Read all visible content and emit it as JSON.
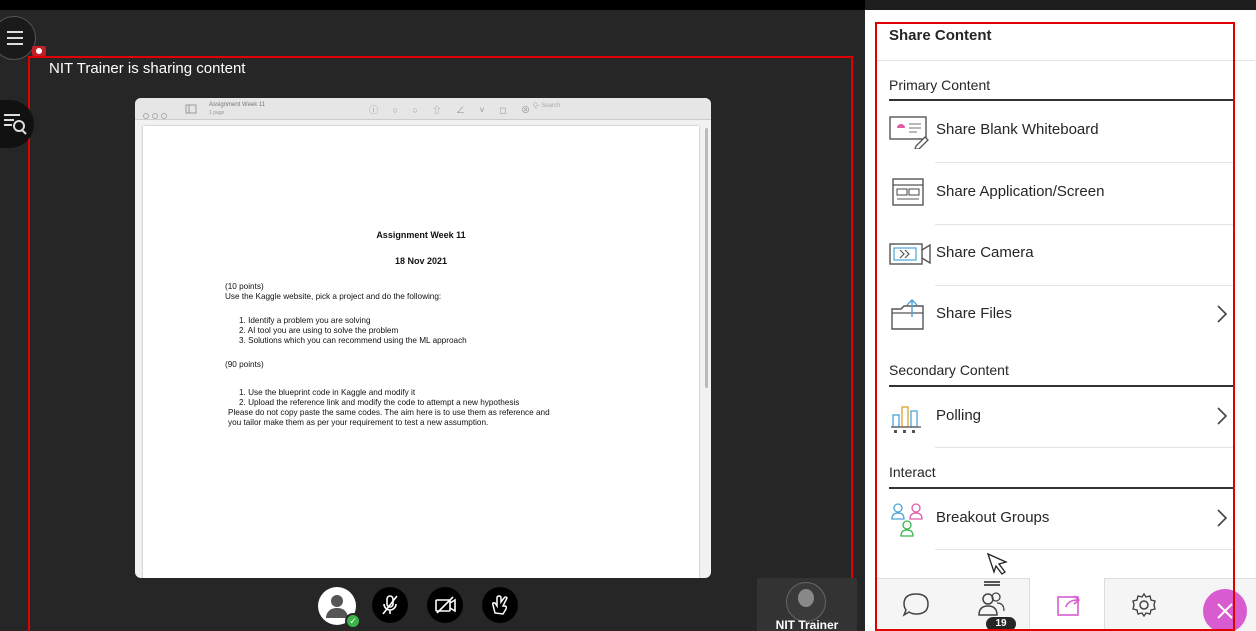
{
  "stage": {
    "sharing_label": "NIT Trainer is sharing content",
    "speaker_name": "NIT Trainer"
  },
  "document": {
    "toolbar_title": "Assignment Week 11",
    "toolbar_sub": "1 page",
    "toolbar_search": "Q- Search",
    "title": "Assignment Week 11",
    "date": "18 Nov 2021",
    "part1_points": "(10 points)",
    "part1_intro": "Use the Kaggle website, pick a project and do the following:",
    "part1_items": [
      "1.   Identify a problem you are solving",
      "2.   AI tool you are using to solve the problem",
      "3.   Solutions which you can recommend using the ML approach"
    ],
    "part2_points": "(90 points)",
    "part2_items": [
      "1.   Use the blueprint code in Kaggle and modify it",
      "2.   Upload the reference link and modify the code to attempt a new hypothesis"
    ],
    "part2_note_1": "Please do not copy paste the same codes. The aim here is to use them as reference and",
    "part2_note_2": "you tailor make them as per your requirement to test a new assumption."
  },
  "panel": {
    "title": "Share Content",
    "sections": {
      "primary": "Primary Content",
      "secondary": "Secondary Content",
      "interact": "Interact"
    },
    "items": {
      "whiteboard": "Share Blank Whiteboard",
      "screen": "Share Application/Screen",
      "camera": "Share Camera",
      "files": "Share Files",
      "polling": "Polling",
      "breakout": "Breakout Groups"
    },
    "attendee_count": "19"
  },
  "colors": {
    "accent": "#d95bd0",
    "highlight_outline": "#e00000",
    "status_green": "#3bb54a",
    "stage_bg": "#262626"
  }
}
